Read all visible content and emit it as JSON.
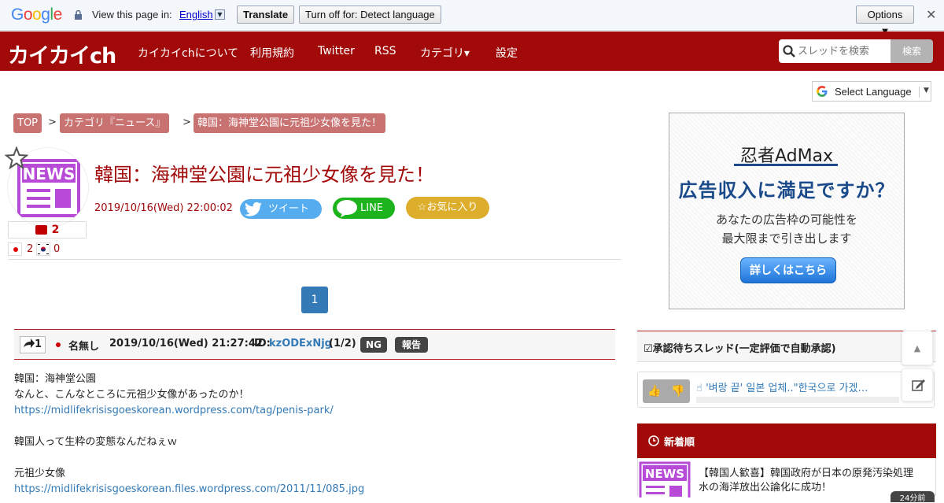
{
  "gtranslate": {
    "view_text": "View this page in:",
    "language": "English",
    "translate_button": "Translate",
    "turnoff_button": "Turn off for: Detect language",
    "options_button": "Options ▼",
    "close": "✕"
  },
  "nav": {
    "brand": "カイカイch",
    "items": [
      "カイカイchについて",
      "利用規約",
      "Twitter",
      "RSS",
      "カテゴリ▾",
      "設定"
    ],
    "search_placeholder": "スレッドを検索",
    "search_button": "検索"
  },
  "select_language": "Select Language",
  "breadcrumb": [
    "TOP",
    "カテゴリ『ニュース』",
    "韓国：海神堂公園に元祖少女像を見た！"
  ],
  "breadcrumb_sep": ">",
  "thread": {
    "title": "韓国：海神堂公園に元祖少女像を見た！",
    "date": "2019/10/16(Wed) 22:00:02",
    "tweet_label": "ツイート",
    "line_label": "LINE",
    "fav_label": "☆お気に入り",
    "comment_count": "2",
    "jp_count": "2",
    "kr_count": "0"
  },
  "pager": {
    "current": "1"
  },
  "post": {
    "res_num": "1",
    "name": "名無し",
    "date": "2019/10/16(Wed) 21:27:42",
    "id_label": "ID:",
    "id": "kzODExNjg",
    "id_count": "(1/2)",
    "ng_label": "NG",
    "report_label": "報告",
    "lines": [
      {
        "text": "韓国：海神堂公園",
        "link": false
      },
      {
        "text": "なんと、こんなところに元祖少女像があったのか！",
        "link": false
      },
      {
        "text": "https://midlifekrisisgoeskorean.wordpress.com/tag/penis-park/",
        "link": true
      },
      {
        "text": "",
        "link": false
      },
      {
        "text": "韓国人って生粋の変態なんだねぇｗ",
        "link": false
      },
      {
        "text": "",
        "link": false
      },
      {
        "text": "元祖少女像",
        "link": false
      },
      {
        "text": "https://midlifekrisisgoeskorean.files.wordpress.com/2011/11/085.jpg",
        "link": true
      }
    ]
  },
  "ad": {
    "logo": "忍者AdMax",
    "headline": "広告収入に満足ですか？",
    "sub1": "あなたの広告枠の可能性を",
    "sub2": "最大限まで引き出します",
    "cta": "詳しくはこちら"
  },
  "sidebar": {
    "pending_title": "承認待ちスレッド(一定評価で自動承認)",
    "pending_item": "'벼랑 끝' 일본 업체..\"한국으로 가겠…",
    "new_title": "新着順",
    "new_item_line1": "【韓国人歓喜】韓国政府が日本の原発汚染処理",
    "new_item_line2": "水の海洋放出公論化に成功！",
    "new_item_badge": "24分前"
  },
  "colors": {
    "brand_red": "#a20a0a",
    "crumb": "#c97272",
    "link_blue": "#337ab7",
    "twitter": "#55acee",
    "line": "#1db31d",
    "fav": "#dcae2c",
    "news_purple": "#b84ad8"
  }
}
